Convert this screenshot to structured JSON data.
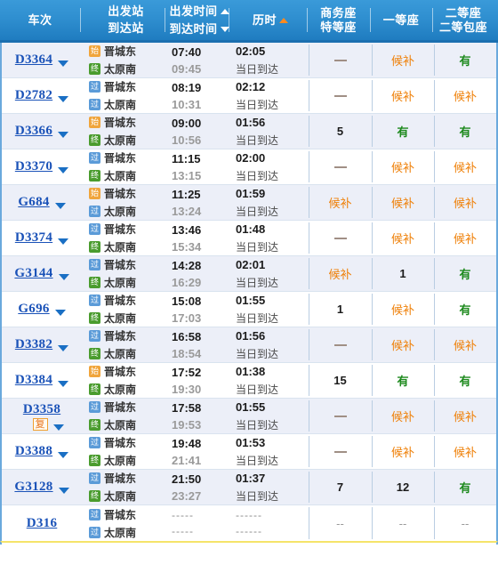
{
  "header": {
    "columns": [
      {
        "id": "train",
        "line1": "车次",
        "line2": "",
        "sort": "none"
      },
      {
        "id": "station",
        "line1": "出发站",
        "line2": "到达站",
        "sort": "none"
      },
      {
        "id": "time",
        "line1": "出发时间",
        "line2": "到达时间",
        "sort": "both"
      },
      {
        "id": "duration",
        "line1": "历时",
        "line2": "",
        "sort": "up-active"
      },
      {
        "id": "business",
        "line1": "商务座",
        "line2": "特等座",
        "sort": "none"
      },
      {
        "id": "first",
        "line1": "一等座",
        "line2": "",
        "sort": "none"
      },
      {
        "id": "second",
        "line1": "二等座",
        "line2": "二等包座",
        "sort": "none"
      }
    ]
  },
  "legend": {
    "start_label": "始",
    "end_label": "终",
    "pass_label": "过",
    "resume_label": "复"
  },
  "colors": {
    "header_blue": "#2f8fd0",
    "train_link": "#1a52b8",
    "available_green": "#1e8a1e",
    "waitlist_orange": "#ef8008",
    "badge_start": "#f0a53c",
    "badge_end": "#4a9c2e",
    "badge_pass": "#5b9bd8",
    "row_alt": "#eceff8"
  },
  "rows": [
    {
      "train_no": "D3364",
      "has_caret": true,
      "resume": false,
      "from_badge": "始",
      "from_station": "晋城东",
      "to_badge": "终",
      "to_station": "太原南",
      "depart": "07:40",
      "arrive": "09:45",
      "duration": "02:05",
      "arrive_note": "当日到达",
      "business": "—",
      "first": "候补",
      "second": "有"
    },
    {
      "train_no": "D2782",
      "has_caret": true,
      "resume": false,
      "from_badge": "过",
      "from_station": "晋城东",
      "to_badge": "过",
      "to_station": "太原南",
      "depart": "08:19",
      "arrive": "10:31",
      "duration": "02:12",
      "arrive_note": "当日到达",
      "business": "—",
      "first": "候补",
      "second": "候补"
    },
    {
      "train_no": "D3366",
      "has_caret": true,
      "resume": false,
      "from_badge": "始",
      "from_station": "晋城东",
      "to_badge": "终",
      "to_station": "太原南",
      "depart": "09:00",
      "arrive": "10:56",
      "duration": "01:56",
      "arrive_note": "当日到达",
      "business": "5",
      "first": "有",
      "second": "有"
    },
    {
      "train_no": "D3370",
      "has_caret": true,
      "resume": false,
      "from_badge": "过",
      "from_station": "晋城东",
      "to_badge": "终",
      "to_station": "太原南",
      "depart": "11:15",
      "arrive": "13:15",
      "duration": "02:00",
      "arrive_note": "当日到达",
      "business": "—",
      "first": "候补",
      "second": "候补"
    },
    {
      "train_no": "G684",
      "has_caret": true,
      "resume": false,
      "from_badge": "始",
      "from_station": "晋城东",
      "to_badge": "过",
      "to_station": "太原南",
      "depart": "11:25",
      "arrive": "13:24",
      "duration": "01:59",
      "arrive_note": "当日到达",
      "business": "候补",
      "first": "候补",
      "second": "候补"
    },
    {
      "train_no": "D3374",
      "has_caret": true,
      "resume": false,
      "from_badge": "过",
      "from_station": "晋城东",
      "to_badge": "终",
      "to_station": "太原南",
      "depart": "13:46",
      "arrive": "15:34",
      "duration": "01:48",
      "arrive_note": "当日到达",
      "business": "—",
      "first": "候补",
      "second": "候补"
    },
    {
      "train_no": "G3144",
      "has_caret": true,
      "resume": false,
      "from_badge": "过",
      "from_station": "晋城东",
      "to_badge": "终",
      "to_station": "太原南",
      "depart": "14:28",
      "arrive": "16:29",
      "duration": "02:01",
      "arrive_note": "当日到达",
      "business": "候补",
      "first": "1",
      "second": "有"
    },
    {
      "train_no": "G696",
      "has_caret": true,
      "resume": false,
      "from_badge": "过",
      "from_station": "晋城东",
      "to_badge": "终",
      "to_station": "太原南",
      "depart": "15:08",
      "arrive": "17:03",
      "duration": "01:55",
      "arrive_note": "当日到达",
      "business": "1",
      "first": "候补",
      "second": "有"
    },
    {
      "train_no": "D3382",
      "has_caret": true,
      "resume": false,
      "from_badge": "过",
      "from_station": "晋城东",
      "to_badge": "终",
      "to_station": "太原南",
      "depart": "16:58",
      "arrive": "18:54",
      "duration": "01:56",
      "arrive_note": "当日到达",
      "business": "—",
      "first": "候补",
      "second": "候补"
    },
    {
      "train_no": "D3384",
      "has_caret": true,
      "resume": false,
      "from_badge": "始",
      "from_station": "晋城东",
      "to_badge": "终",
      "to_station": "太原南",
      "depart": "17:52",
      "arrive": "19:30",
      "duration": "01:38",
      "arrive_note": "当日到达",
      "business": "15",
      "first": "有",
      "second": "有"
    },
    {
      "train_no": "D3358",
      "has_caret": true,
      "resume": true,
      "from_badge": "过",
      "from_station": "晋城东",
      "to_badge": "终",
      "to_station": "太原南",
      "depart": "17:58",
      "arrive": "19:53",
      "duration": "01:55",
      "arrive_note": "当日到达",
      "business": "—",
      "first": "候补",
      "second": "候补"
    },
    {
      "train_no": "D3388",
      "has_caret": true,
      "resume": false,
      "from_badge": "过",
      "from_station": "晋城东",
      "to_badge": "终",
      "to_station": "太原南",
      "depart": "19:48",
      "arrive": "21:41",
      "duration": "01:53",
      "arrive_note": "当日到达",
      "business": "—",
      "first": "候补",
      "second": "候补"
    },
    {
      "train_no": "G3128",
      "has_caret": true,
      "resume": false,
      "from_badge": "过",
      "from_station": "晋城东",
      "to_badge": "终",
      "to_station": "太原南",
      "depart": "21:50",
      "arrive": "23:27",
      "duration": "01:37",
      "arrive_note": "当日到达",
      "business": "7",
      "first": "12",
      "second": "有"
    },
    {
      "train_no": "D316",
      "has_caret": false,
      "resume": false,
      "from_badge": "过",
      "from_station": "晋城东",
      "to_badge": "过",
      "to_station": "太原南",
      "depart": "-----",
      "arrive": "-----",
      "duration": "------",
      "arrive_note": "------",
      "business": "--",
      "first": "--",
      "second": "--"
    }
  ]
}
